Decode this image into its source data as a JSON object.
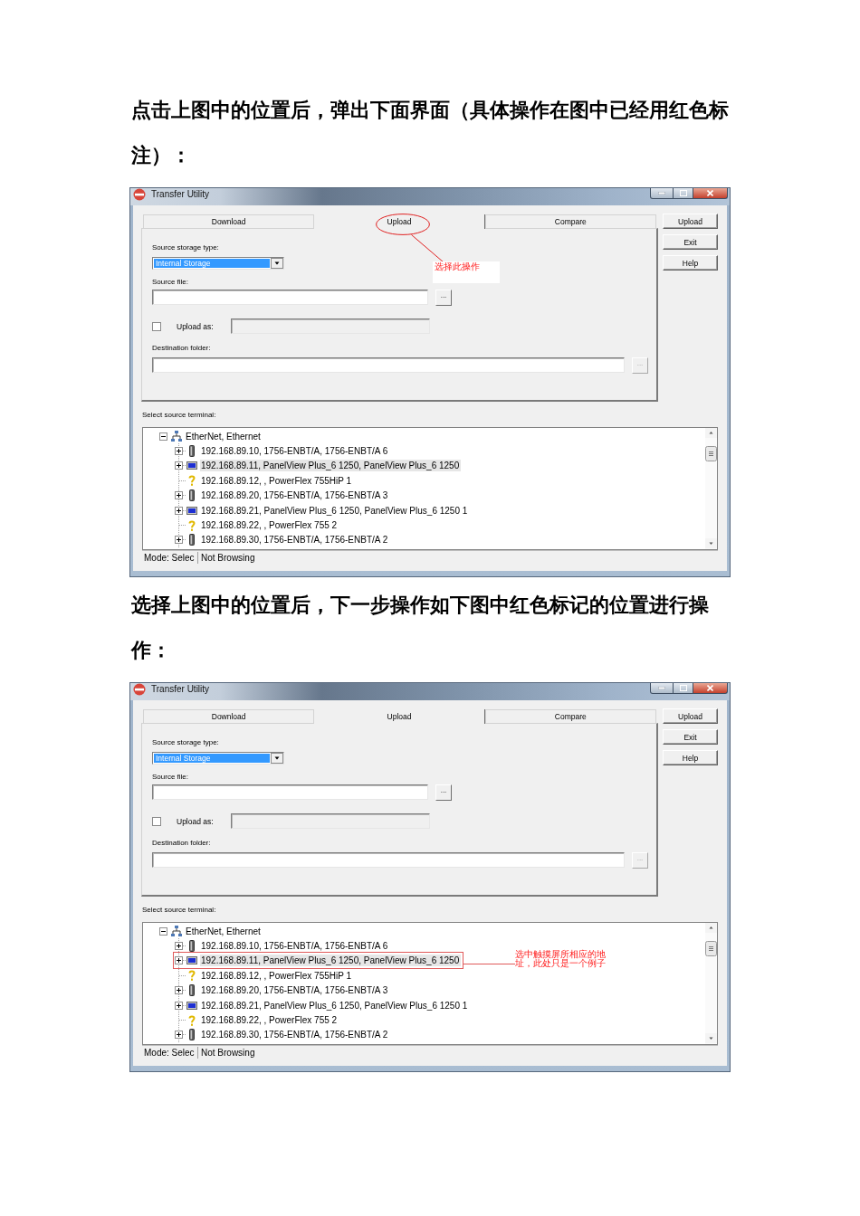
{
  "blocks": [
    {
      "kind": "paragraph",
      "text": "点击上图中的位置后，弹出下面界面（具体操作在图中已经用红色标注）："
    },
    {
      "kind": "screenshot",
      "window": {
        "title": "Transfer Utility",
        "tabs": [
          {
            "label": "Download",
            "selected": false
          },
          {
            "label": "Upload",
            "selected": true
          },
          {
            "label": "Compare",
            "selected": false
          }
        ],
        "buttons": [
          "Upload",
          "Exit",
          "Help"
        ],
        "source_storage": {
          "label": "Source storage type:",
          "value": "Internal Storage",
          "highlighted": true
        },
        "source_file": {
          "label": "Source file:",
          "browse": "...",
          "browse_disabled": false
        },
        "upload_as": {
          "label": "Upload as:",
          "checked": false,
          "disabled": true
        },
        "destination_folder": {
          "label": "Destination folder:",
          "browse": "...",
          "browse_disabled": true
        },
        "terminal_label": "Select source terminal:",
        "tree": [
          {
            "label": "EtherNet, Ethernet",
            "kind": "network",
            "has_children": true,
            "expanded": true,
            "selected": false,
            "children": [
              {
                "label": "192.168.89.10, 1756-ENBT/A, 1756-ENBT/A 6",
                "kind": "module",
                "has_children": true,
                "selected": false
              },
              {
                "label": "192.168.89.11, PanelView Plus_6 1250, PanelView Plus_6 1250",
                "kind": "panel",
                "has_children": true,
                "selected": true
              },
              {
                "label": "192.168.89.12, , PowerFlex 755HiP 1",
                "kind": "unknown",
                "has_children": false,
                "selected": false
              },
              {
                "label": "192.168.89.20, 1756-ENBT/A, 1756-ENBT/A 3",
                "kind": "module",
                "has_children": true,
                "selected": false
              },
              {
                "label": "192.168.89.21, PanelView Plus_6 1250, PanelView Plus_6 1250 1",
                "kind": "panel",
                "has_children": true,
                "selected": false
              },
              {
                "label": "192.168.89.22, , PowerFlex 755 2",
                "kind": "unknown",
                "has_children": false,
                "selected": false
              },
              {
                "label": "192.168.89.30, 1756-ENBT/A, 1756-ENBT/A 2",
                "kind": "module",
                "has_children": true,
                "selected": false
              }
            ]
          }
        ],
        "status_bar": [
          "Mode: Selec",
          "Not Browsing"
        ]
      },
      "annotation": {
        "kind": "circled-tab",
        "text": "选择此操作"
      }
    },
    {
      "kind": "paragraph",
      "text": "选择上图中的位置后，下一步操作如下图中红色标记的位置进行操作："
    },
    {
      "kind": "screenshot",
      "window": {
        "title": "Transfer Utility",
        "tabs": [
          {
            "label": "Download",
            "selected": false
          },
          {
            "label": "Upload",
            "selected": true
          },
          {
            "label": "Compare",
            "selected": false
          }
        ],
        "buttons": [
          "Upload",
          "Exit",
          "Help"
        ],
        "source_storage": {
          "label": "Source storage type:",
          "value": "Internal Storage",
          "highlighted": true
        },
        "source_file": {
          "label": "Source file:",
          "browse": "...",
          "browse_disabled": false
        },
        "upload_as": {
          "label": "Upload as:",
          "checked": false,
          "disabled": true
        },
        "destination_folder": {
          "label": "Destination folder:",
          "browse": "...",
          "browse_disabled": true
        },
        "terminal_label": "Select source terminal:",
        "tree": [
          {
            "label": "EtherNet, Ethernet",
            "kind": "network",
            "has_children": true,
            "expanded": true,
            "selected": false,
            "children": [
              {
                "label": "192.168.89.10, 1756-ENBT/A, 1756-ENBT/A 6",
                "kind": "module",
                "has_children": true,
                "selected": false
              },
              {
                "label": "192.168.89.11, PanelView Plus_6 1250, PanelView Plus_6 1250",
                "kind": "panel",
                "has_children": true,
                "selected": true
              },
              {
                "label": "192.168.89.12, , PowerFlex 755HiP 1",
                "kind": "unknown",
                "has_children": false,
                "selected": false
              },
              {
                "label": "192.168.89.20, 1756-ENBT/A, 1756-ENBT/A 3",
                "kind": "module",
                "has_children": true,
                "selected": false
              },
              {
                "label": "192.168.89.21, PanelView Plus_6 1250, PanelView Plus_6 1250 1",
                "kind": "panel",
                "has_children": true,
                "selected": false
              },
              {
                "label": "192.168.89.22, , PowerFlex 755 2",
                "kind": "unknown",
                "has_children": false,
                "selected": false
              },
              {
                "label": "192.168.89.30, 1756-ENBT/A, 1756-ENBT/A 2",
                "kind": "module",
                "has_children": true,
                "selected": false
              }
            ]
          }
        ],
        "status_bar": [
          "Mode: Selec",
          "Not Browsing"
        ]
      },
      "annotation": {
        "kind": "boxed-row",
        "text": "选中触摸屏所相应的地址，此处只是一个例子"
      }
    }
  ]
}
